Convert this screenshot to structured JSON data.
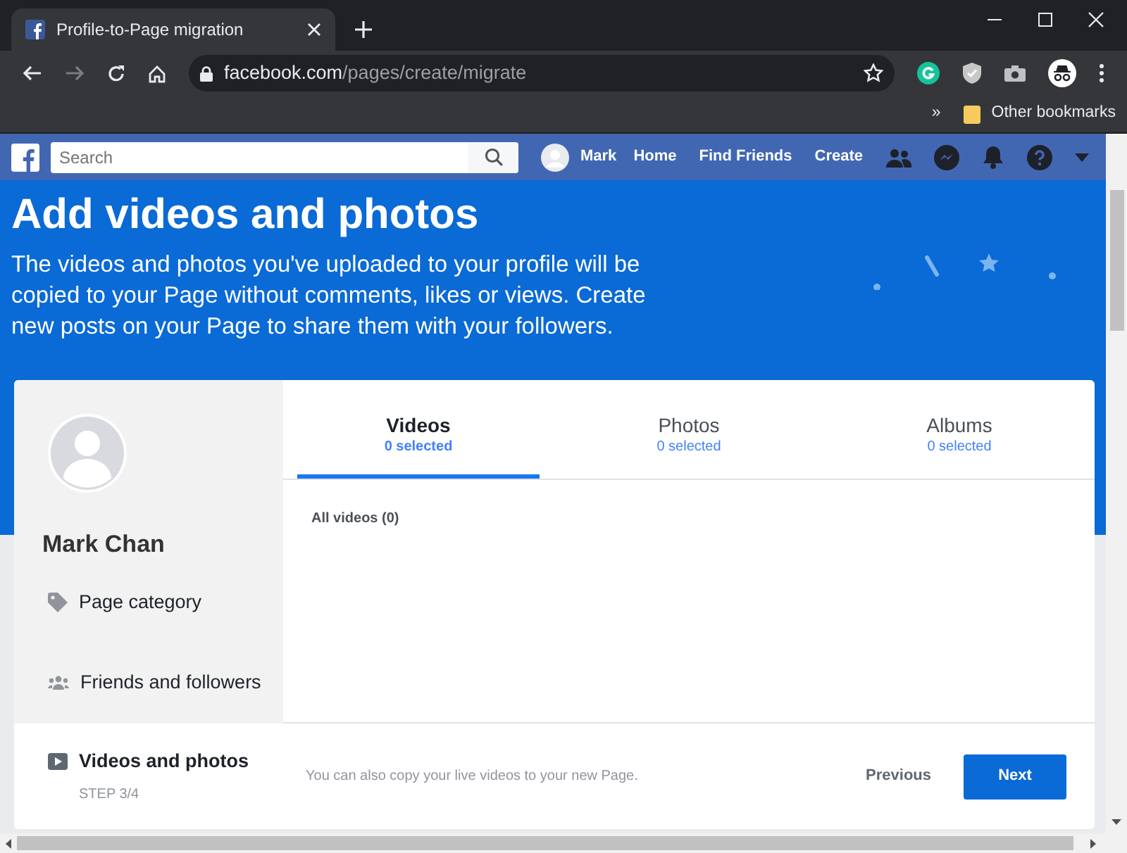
{
  "browser": {
    "tab_title": "Profile-to-Page migration",
    "address": {
      "domain": "facebook.com",
      "path": "/pages/create/migrate"
    },
    "bookmarks_overflow": "»",
    "bookmarks": [
      "Other bookmarks"
    ]
  },
  "nav": {
    "search": {
      "placeholder": "Search"
    },
    "profile": "Mark",
    "links": [
      "Home",
      "Find Friends",
      "Create"
    ]
  },
  "hero": {
    "title": "Add videos and photos",
    "description": "The videos and photos you've uploaded to your profile will be copied to your Page without comments, likes or views. Create new posts on your Page to share them with your followers."
  },
  "sidebar": {
    "name": "Mark Chan",
    "steps": [
      {
        "label": "Page category",
        "selected": false
      },
      {
        "label": "Friends and followers",
        "selected": false
      },
      {
        "label": "Videos and photos",
        "selected": true,
        "step": "STEP 3/4"
      }
    ]
  },
  "tabs": [
    {
      "label": "Videos",
      "count": "0 selected",
      "selected": true
    },
    {
      "label": "Photos",
      "count": "0 selected",
      "selected": false
    },
    {
      "label": "Albums",
      "count": "0 selected",
      "selected": false
    }
  ],
  "content": {
    "heading": "All videos (0)"
  },
  "footer": {
    "note": "You can also copy your live videos to your new Page.",
    "buttons": [
      "Previous",
      "Next"
    ]
  }
}
